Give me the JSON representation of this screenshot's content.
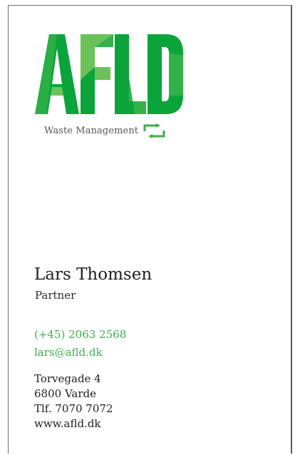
{
  "brand": {
    "logo_text": "AFLD",
    "tagline": "Waste Management",
    "tagline_icon": "recycle-arrows-icon",
    "colors": {
      "primary_green": "#0aa43b",
      "light_green": "#6ac259",
      "accent_text_green": "#3eae4b"
    }
  },
  "person": {
    "name": "Lars Thomsen",
    "title": "Partner"
  },
  "contact": {
    "phone": "(+45) 2063 2568",
    "email": "lars@afld.dk"
  },
  "address": {
    "street": "Torvegade 4",
    "city": "6800 Varde",
    "phone": "Tlf. 7070 7072",
    "website": "www.afld.dk"
  }
}
